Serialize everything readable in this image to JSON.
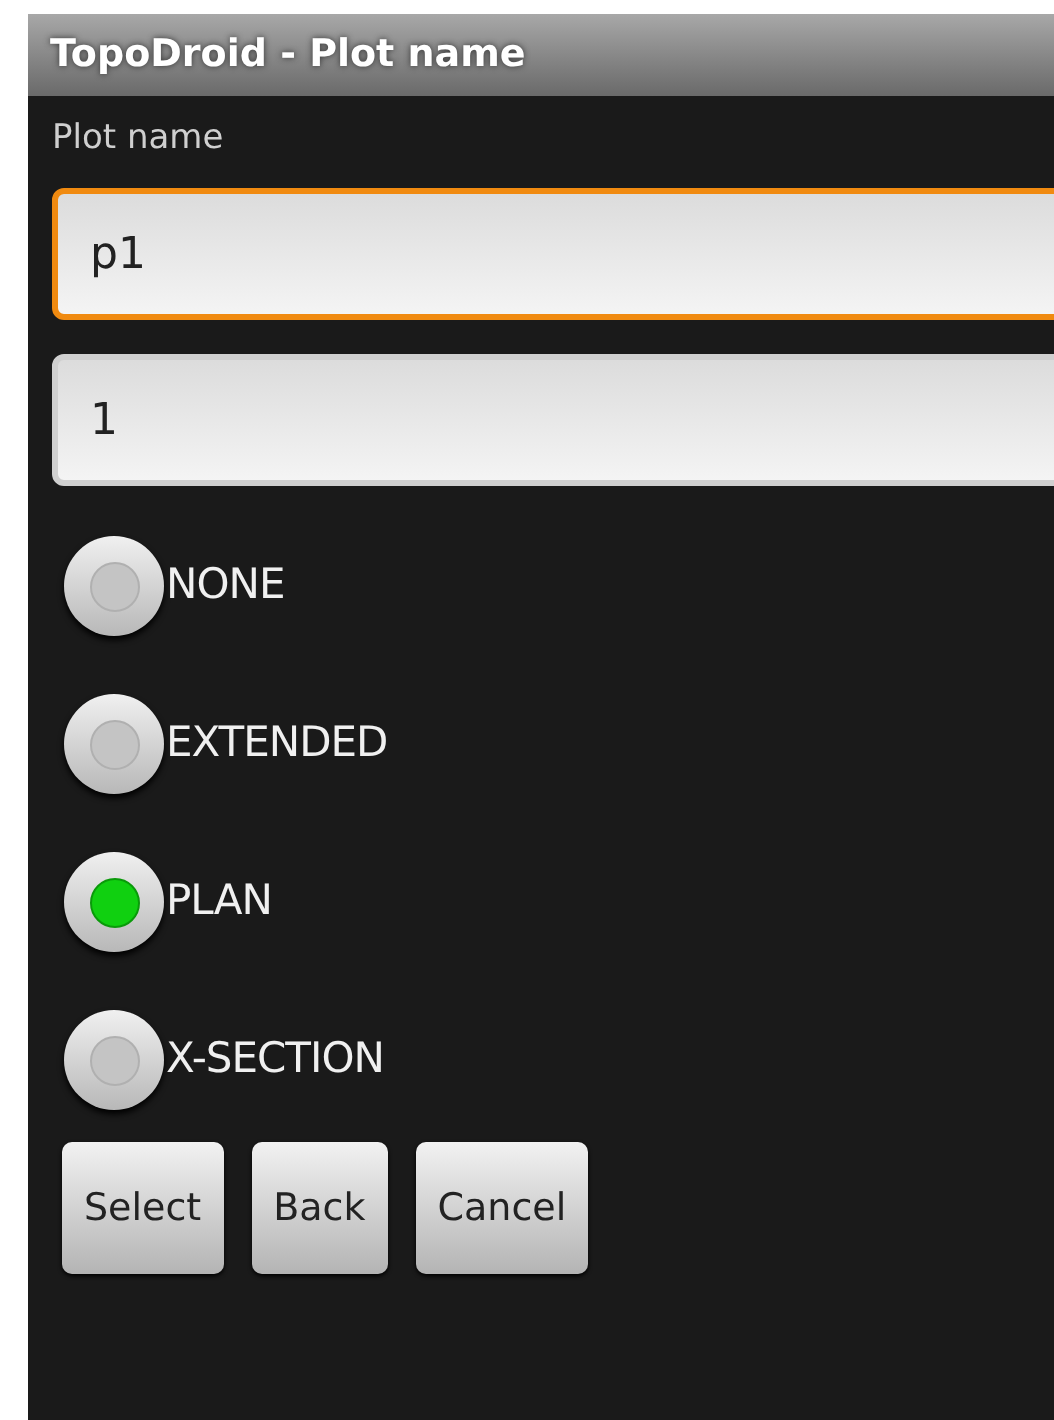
{
  "window": {
    "title": "TopoDroid - Plot name"
  },
  "label": "Plot name",
  "fields": [
    {
      "value": "p1",
      "focused": true
    },
    {
      "value": "1",
      "focused": false
    }
  ],
  "options": [
    {
      "label": "NONE",
      "selected": false
    },
    {
      "label": "EXTENDED",
      "selected": false
    },
    {
      "label": "PLAN",
      "selected": true
    },
    {
      "label": "X-SECTION",
      "selected": false
    }
  ],
  "buttons": [
    "Select",
    "Back",
    "Cancel"
  ]
}
